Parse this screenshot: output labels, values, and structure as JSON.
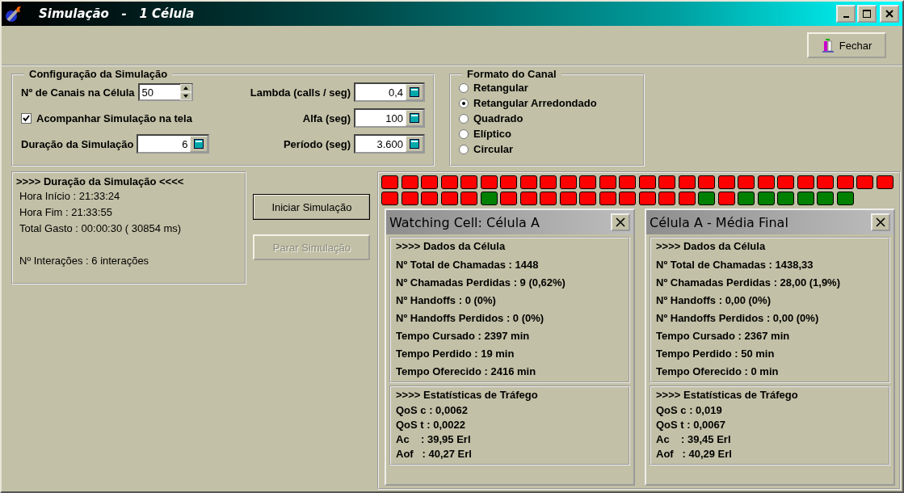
{
  "window": {
    "title": "Simulação   -   1 Célula"
  },
  "toolbar": {
    "close_button": "Fechar"
  },
  "config": {
    "title": "Configuração da Simulação",
    "left": [
      {
        "kind": "spin",
        "label": "Nº de Canais na Célula",
        "value": "50"
      },
      {
        "kind": "check",
        "label": "Acompanhar Simulação na tela",
        "checked": true
      },
      {
        "kind": "calc",
        "label": "Duração da Simulação",
        "value": "6"
      }
    ],
    "right": [
      {
        "label": "Lambda (calls / seg)",
        "value": "0,4"
      },
      {
        "label": "Alfa (seg)",
        "value": "100"
      },
      {
        "label": "Período  (seg)",
        "value": "3.600"
      }
    ]
  },
  "channel_format": {
    "title": "Formato do Canal",
    "options": [
      {
        "label": "Retangular",
        "selected": false
      },
      {
        "label": "Retangular Arredondado",
        "selected": true
      },
      {
        "label": "Quadrado",
        "selected": false
      },
      {
        "label": "Elíptico",
        "selected": false
      },
      {
        "label": "Circular",
        "selected": false
      }
    ]
  },
  "duration": {
    "title": ">>>> Duração da Simulação <<<<",
    "lines": [
      "Hora Início : 21:33:24",
      "Hora Fim : 21:33:55",
      "Total Gasto : 00:00:30 ( 30854 ms)",
      "Nº Interações : 6 interações"
    ]
  },
  "buttons": [
    {
      "label": "Iniciar Simulação",
      "disabled": false
    },
    {
      "label": "Parar Simulação",
      "disabled": true
    }
  ],
  "channels": [
    {
      "busy": true
    },
    {
      "busy": true
    },
    {
      "busy": true
    },
    {
      "busy": true
    },
    {
      "busy": true
    },
    {
      "busy": true
    },
    {
      "busy": true
    },
    {
      "busy": true
    },
    {
      "busy": true
    },
    {
      "busy": true
    },
    {
      "busy": true
    },
    {
      "busy": true
    },
    {
      "busy": true
    },
    {
      "busy": true
    },
    {
      "busy": true
    },
    {
      "busy": true
    },
    {
      "busy": true
    },
    {
      "busy": true
    },
    {
      "busy": true
    },
    {
      "busy": true
    },
    {
      "busy": true
    },
    {
      "busy": true
    },
    {
      "busy": true
    },
    {
      "busy": true
    },
    {
      "busy": true
    },
    {
      "busy": true
    },
    {
      "busy": true
    },
    {
      "busy": true
    },
    {
      "busy": true
    },
    {
      "busy": true
    },
    {
      "busy": true
    },
    {
      "busy": false
    },
    {
      "busy": true
    },
    {
      "busy": true
    },
    {
      "busy": true
    },
    {
      "busy": true
    },
    {
      "busy": true
    },
    {
      "busy": true
    },
    {
      "busy": true
    },
    {
      "busy": true
    },
    {
      "busy": true
    },
    {
      "busy": true
    },
    {
      "busy": false
    },
    {
      "busy": true
    },
    {
      "busy": false
    },
    {
      "busy": false
    },
    {
      "busy": false
    },
    {
      "busy": false
    },
    {
      "busy": false
    },
    {
      "busy": false
    }
  ],
  "panels": [
    {
      "title": "Watching Cell: Célula A",
      "sections": [
        {
          "title": ">>>> Dados da Célula",
          "lines": [
            "Nº Total de Chamadas : 1448",
            "Nº Chamadas Perdidas : 9 (0,62%)",
            "Nº Handoffs : 0 (0%)",
            "Nº Handoffs Perdidos : 0 (0%)",
            "Tempo Cursado : 2397 min",
            "Tempo Perdido : 19 min",
            "Tempo Oferecido : 2416 min"
          ]
        },
        {
          "title": ">>>> Estatísticas de Tráfego",
          "lines": [
            "QoS c : 0,0062",
            "QoS t : 0,0022",
            "Ac    : 39,95 Erl",
            "Aof   : 40,27 Erl"
          ]
        }
      ]
    },
    {
      "title": "Célula A - Média Final",
      "sections": [
        {
          "title": ">>>> Dados da Célula",
          "lines": [
            "Nº Total de Chamadas : 1438,33",
            "Nº Chamadas Perdidas : 28,00 (1,9%)",
            "Nº Handoffs : 0,00 (0%)",
            "Nº Handoffs Perdidos : 0,00 (0%)",
            "Tempo Cursado : 2367 min",
            "Tempo Perdido : 50 min",
            "Tempo Oferecido : 0 min"
          ]
        },
        {
          "title": ">>>> Estatísticas de Tráfego",
          "lines": [
            "QoS c : 0,019",
            "QoS t : 0,0067",
            "Ac    : 39,45 Erl",
            "Aof   : 40,29 Erl"
          ]
        }
      ]
    }
  ]
}
